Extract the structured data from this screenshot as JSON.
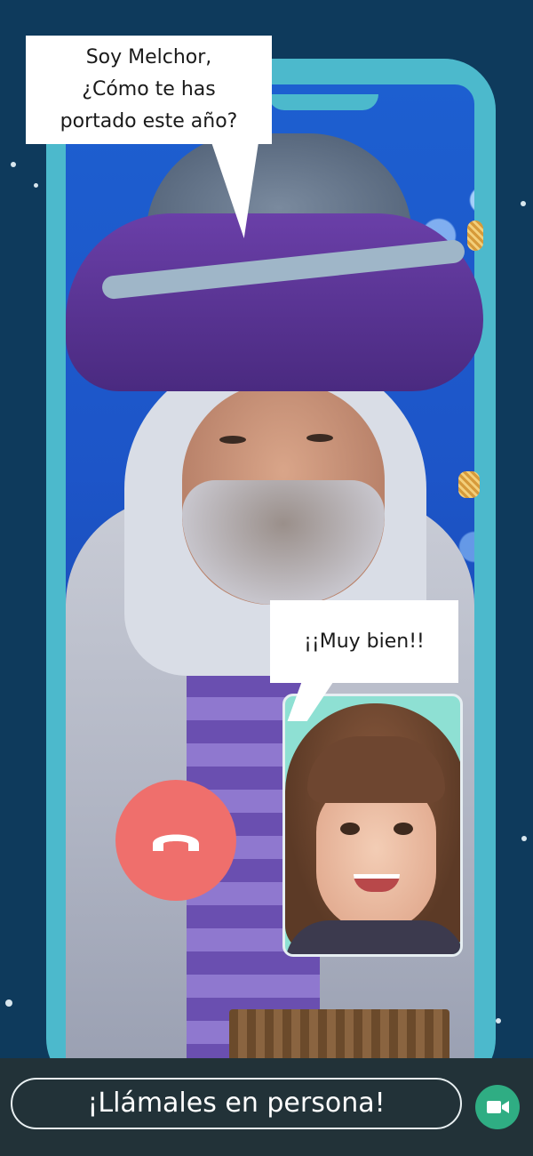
{
  "caller": {
    "speech_line_1": "Soy Melchor,",
    "speech_line_2": "¿Cómo te has",
    "speech_line_3": "portado este año?"
  },
  "child": {
    "reply": "¡¡Muy bien!!"
  },
  "controls": {
    "end_call_icon": "phone-hangup-icon",
    "video_icon": "video-camera-icon"
  },
  "footer": {
    "cta_label": "¡Llámales en persona!"
  },
  "colors": {
    "background": "#0e3a5c",
    "phone_frame": "#4cb9cc",
    "end_call": "#ef6f6c",
    "video_button": "#2fad83",
    "bottom_bar": "#223238"
  }
}
